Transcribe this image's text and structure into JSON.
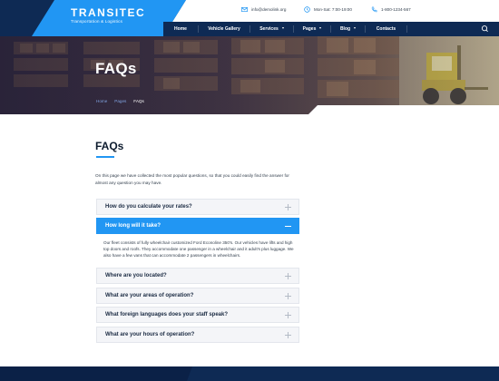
{
  "brand": {
    "name": "TRANSITEC",
    "tagline": "Transportation & Logistics"
  },
  "contacts": {
    "email": "info@demolink.org",
    "hours": "Mon-Sat: 7:00-19:00",
    "phone": "1-800-1234-567"
  },
  "nav": {
    "items": [
      {
        "label": "Home"
      },
      {
        "label": "Vehicle Gallery"
      },
      {
        "label": "Services"
      },
      {
        "label": "Pages"
      },
      {
        "label": "Blog"
      },
      {
        "label": "Contacts"
      }
    ]
  },
  "hero": {
    "title": "FAQs",
    "breadcrumb": [
      "Home",
      "Pages",
      "FAQs"
    ]
  },
  "content": {
    "title": "FAQs",
    "intro": "On this page we have collected the most popular questions, so that you could easily find the answer for almost any question you may have.",
    "faqs": [
      {
        "question": "How do you calculate your rates?"
      },
      {
        "question": "How long will it take?"
      },
      {
        "question": "Where are you located?"
      },
      {
        "question": "What are your areas of operation?"
      },
      {
        "question": "What foreign languages does your staff speak?"
      },
      {
        "question": "What are your hours of operation?"
      }
    ],
    "answer": "Our fleet consists of fully wheelchair customized Ford Econoline 350's. Our vehicles have lifts and high top doors and roofs. They accommodate one passenger in a wheelchair and it adult's plus luggage. We also have a few vans that can accommodate 2 passengers in wheelchairs."
  },
  "colors": {
    "accent": "#2196f3",
    "navy": "#0e2a54"
  }
}
